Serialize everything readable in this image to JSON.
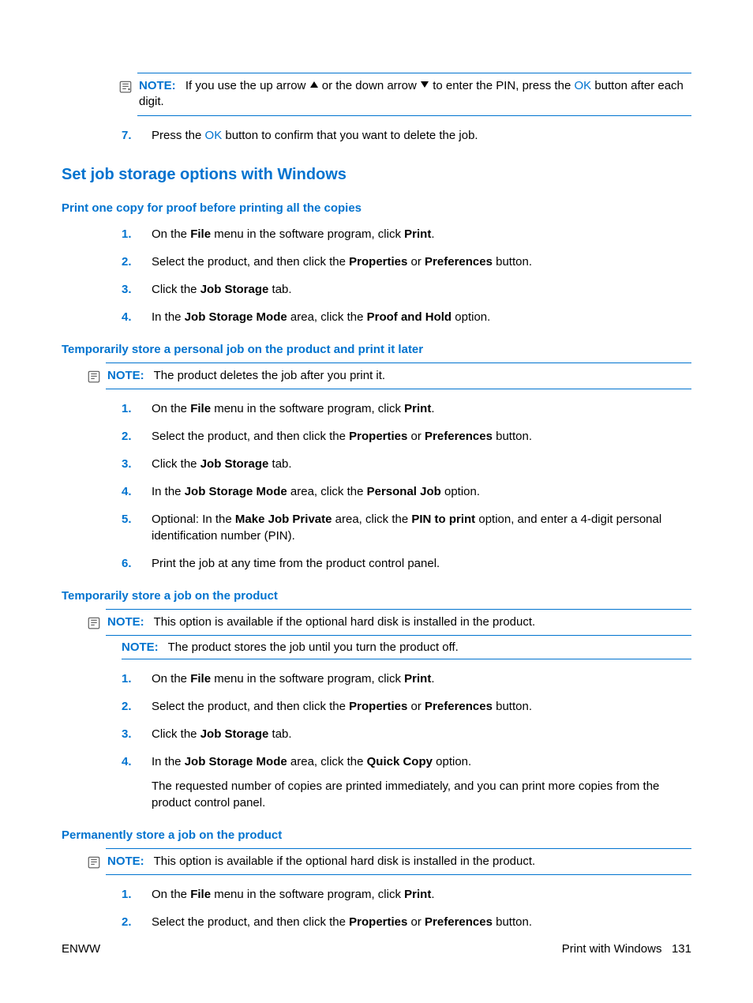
{
  "topNote": {
    "label": "NOTE:",
    "prefix": "If you use the up arrow ",
    "mid": " or the down arrow ",
    "afterArrows": " to enter the PIN, press the ",
    "ok": "OK",
    "suffix": " button after each digit."
  },
  "step7": {
    "num": "7.",
    "before": "Press the ",
    "ok": "OK",
    "after": " button to confirm that you want to delete the job."
  },
  "h2": "Set job storage options with Windows",
  "sectionA": {
    "title": "Print one copy for proof before printing all the copies",
    "steps": {
      "s1": {
        "num": "1.",
        "a": "On the ",
        "b": "File",
        "c": " menu in the software program, click ",
        "d": "Print",
        "e": "."
      },
      "s2": {
        "num": "2.",
        "a": "Select the product, and then click the ",
        "b": "Properties",
        "c": " or ",
        "d": "Preferences",
        "e": " button."
      },
      "s3": {
        "num": "3.",
        "a": "Click the ",
        "b": "Job Storage",
        "c": " tab."
      },
      "s4": {
        "num": "4.",
        "a": "In the ",
        "b": "Job Storage Mode",
        "c": " area, click the ",
        "d": "Proof and Hold",
        "e": " option."
      }
    }
  },
  "sectionB": {
    "title": "Temporarily store a personal job on the product and print it later",
    "note": {
      "label": "NOTE:",
      "text": "The product deletes the job after you print it."
    },
    "steps": {
      "s1": {
        "num": "1.",
        "a": "On the ",
        "b": "File",
        "c": " menu in the software program, click ",
        "d": "Print",
        "e": "."
      },
      "s2": {
        "num": "2.",
        "a": "Select the product, and then click the ",
        "b": "Properties",
        "c": " or ",
        "d": "Preferences",
        "e": " button."
      },
      "s3": {
        "num": "3.",
        "a": "Click the ",
        "b": "Job Storage",
        "c": " tab."
      },
      "s4": {
        "num": "4.",
        "a": "In the ",
        "b": "Job Storage Mode",
        "c": " area, click the ",
        "d": "Personal Job",
        "e": " option."
      },
      "s5": {
        "num": "5.",
        "a": "Optional: In the ",
        "b": "Make Job Private",
        "c": " area, click the ",
        "d": "PIN to print",
        "e": " option, and enter a 4-digit personal identification number (PIN)."
      },
      "s6": {
        "num": "6.",
        "text": "Print the job at any time from the product control panel."
      }
    }
  },
  "sectionC": {
    "title": "Temporarily store a job on the product",
    "note1": {
      "label": "NOTE:",
      "text": "This option is available if the optional hard disk is installed in the product."
    },
    "note2": {
      "label": "NOTE:",
      "text": "The product stores the job until you turn the product off."
    },
    "steps": {
      "s1": {
        "num": "1.",
        "a": "On the ",
        "b": "File",
        "c": " menu in the software program, click ",
        "d": "Print",
        "e": "."
      },
      "s2": {
        "num": "2.",
        "a": "Select the product, and then click the ",
        "b": "Properties",
        "c": " or ",
        "d": "Preferences",
        "e": " button."
      },
      "s3": {
        "num": "3.",
        "a": "Click the ",
        "b": "Job Storage",
        "c": " tab."
      },
      "s4": {
        "num": "4.",
        "a": "In the ",
        "b": "Job Storage Mode",
        "c": " area, click the ",
        "d": "Quick Copy",
        "e": " option.",
        "extra": "The requested number of copies are printed immediately, and you can print more copies from the product control panel."
      }
    }
  },
  "sectionD": {
    "title": "Permanently store a job on the product",
    "note": {
      "label": "NOTE:",
      "text": "This option is available if the optional hard disk is installed in the product."
    },
    "steps": {
      "s1": {
        "num": "1.",
        "a": "On the ",
        "b": "File",
        "c": " menu in the software program, click ",
        "d": "Print",
        "e": "."
      },
      "s2": {
        "num": "2.",
        "a": "Select the product, and then click the ",
        "b": "Properties",
        "c": " or ",
        "d": "Preferences",
        "e": " button."
      }
    }
  },
  "footer": {
    "left": "ENWW",
    "rightLabel": "Print with Windows",
    "pageNum": "131"
  }
}
